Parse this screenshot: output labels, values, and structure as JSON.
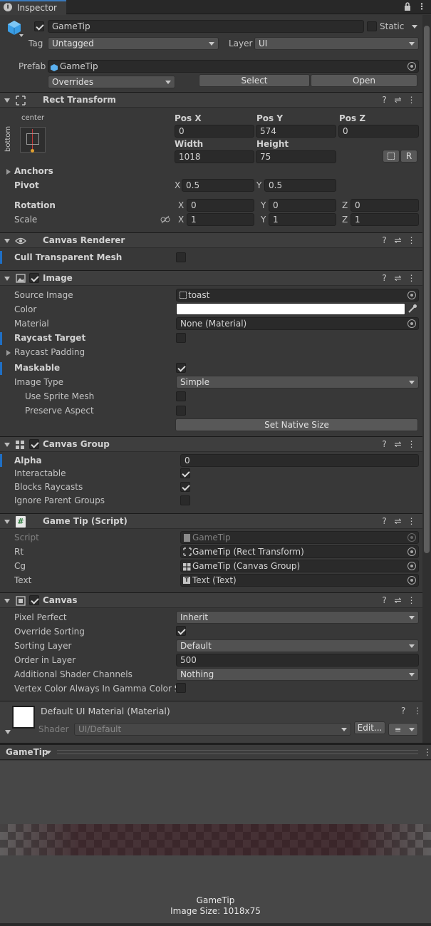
{
  "tab": {
    "title": "Inspector"
  },
  "header": {
    "object_name": "GameTip",
    "static_label": "Static",
    "tag_label": "Tag",
    "tag_value": "Untagged",
    "layer_label": "Layer",
    "layer_value": "UI",
    "prefab_label": "Prefab",
    "prefab_value": "GameTip",
    "overrides_value": "Overrides",
    "select_label": "Select",
    "open_label": "Open"
  },
  "rect_transform": {
    "title": "Rect Transform",
    "anchor_h": "center",
    "anchor_v": "bottom",
    "pos_x_label": "Pos X",
    "pos_y_label": "Pos Y",
    "pos_z_label": "Pos Z",
    "pos_x": "0",
    "pos_y": "574",
    "pos_z": "0",
    "width_label": "Width",
    "height_label": "Height",
    "width": "1018",
    "height": "75",
    "r_label": "R",
    "anchors_label": "Anchors",
    "pivot_label": "Pivot",
    "pivot_x": "0.5",
    "pivot_y": "0.5",
    "rotation_label": "Rotation",
    "rot_x": "0",
    "rot_y": "0",
    "rot_z": "0",
    "scale_label": "Scale",
    "scale_x": "1",
    "scale_y": "1",
    "scale_z": "1",
    "x": "X",
    "y": "Y",
    "z": "Z"
  },
  "canvas_renderer": {
    "title": "Canvas Renderer",
    "cull_label": "Cull Transparent Mesh"
  },
  "image": {
    "title": "Image",
    "source_label": "Source Image",
    "source_value": "toast",
    "color_label": "Color",
    "material_label": "Material",
    "material_value": "None (Material)",
    "raycast_target_label": "Raycast Target",
    "raycast_padding_label": "Raycast Padding",
    "maskable_label": "Maskable",
    "image_type_label": "Image Type",
    "image_type_value": "Simple",
    "use_sprite_mesh_label": "Use Sprite Mesh",
    "preserve_aspect_label": "Preserve Aspect",
    "set_native_label": "Set Native Size"
  },
  "canvas_group": {
    "title": "Canvas Group",
    "alpha_label": "Alpha",
    "alpha_value": "0",
    "interactable_label": "Interactable",
    "blocks_label": "Blocks Raycasts",
    "ignore_label": "Ignore Parent Groups"
  },
  "game_tip": {
    "title": "Game Tip (Script)",
    "script_label": "Script",
    "script_value": "GameTip",
    "rt_label": "Rt",
    "rt_value": "GameTip (Rect Transform)",
    "cg_label": "Cg",
    "cg_value": "GameTip (Canvas Group)",
    "text_label": "Text",
    "text_value": "Text (Text)"
  },
  "canvas": {
    "title": "Canvas",
    "pixel_perfect_label": "Pixel Perfect",
    "pixel_perfect_value": "Inherit",
    "override_sorting_label": "Override Sorting",
    "sorting_layer_label": "Sorting Layer",
    "sorting_layer_value": "Default",
    "order_label": "Order in Layer",
    "order_value": "500",
    "shader_channels_label": "Additional Shader Channels",
    "shader_channels_value": "Nothing",
    "vertex_label": "Vertex Color Always In Gamma Color Spa"
  },
  "material": {
    "title": "Default UI Material (Material)",
    "shader_label": "Shader",
    "shader_value": "UI/Default",
    "edit_label": "Edit..."
  },
  "preview": {
    "dropdown": "GameTip",
    "name": "GameTip",
    "size": "Image Size: 1018x75"
  },
  "colors": {
    "accent": "#1f6fc5",
    "panel": "#383838",
    "field": "#2a2a2a",
    "header": "#3e3e3e"
  }
}
